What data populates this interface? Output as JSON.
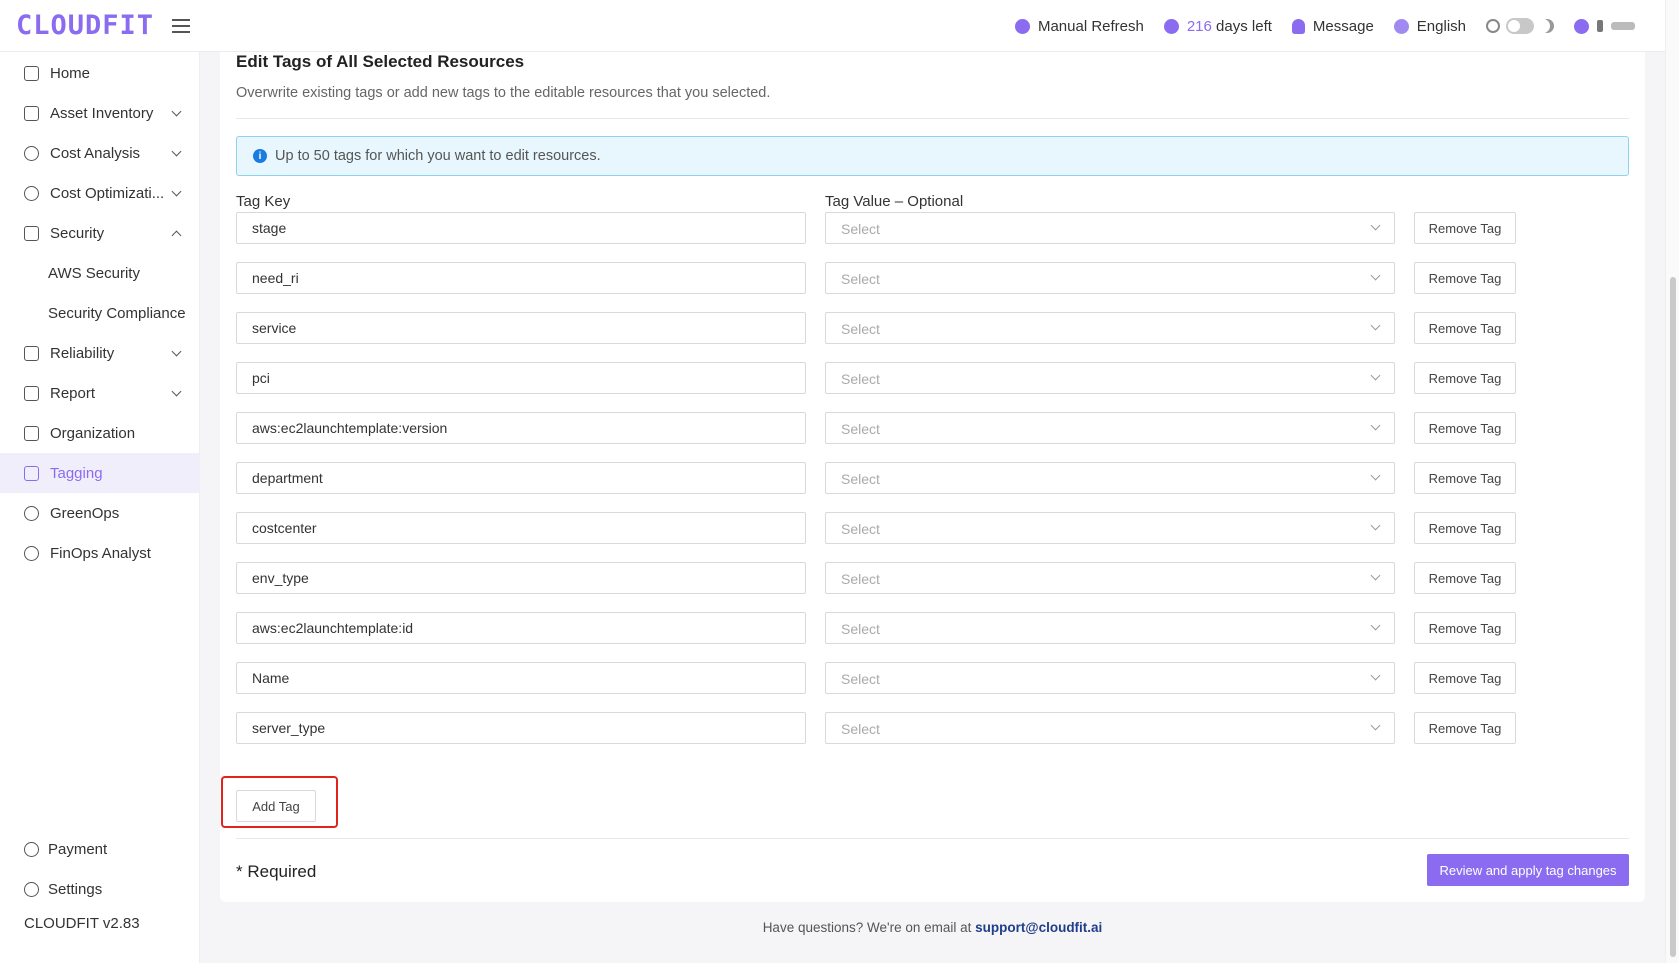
{
  "header": {
    "logo": "CLOUDFIT",
    "manual_refresh": "Manual Refresh",
    "days_left_count": "216",
    "days_left_label": "days left",
    "message": "Message",
    "language": "English"
  },
  "sidebar": {
    "items": [
      {
        "label": "Home",
        "icon": "home-icon"
      },
      {
        "label": "Asset Inventory",
        "icon": "inventory-icon"
      },
      {
        "label": "Cost Analysis",
        "icon": "gauge-icon"
      },
      {
        "label": "Cost Optimizati...",
        "icon": "dollar-icon"
      },
      {
        "label": "Security",
        "icon": "alarm-icon"
      },
      {
        "label": "AWS Security"
      },
      {
        "label": "Security Compliance"
      },
      {
        "label": "Reliability",
        "icon": "report-check-icon"
      },
      {
        "label": "Report",
        "icon": "document-icon"
      },
      {
        "label": "Organization",
        "icon": "org-chart-icon"
      },
      {
        "label": "Tagging",
        "icon": "tag-icon"
      },
      {
        "label": "GreenOps",
        "icon": "leaf-icon"
      },
      {
        "label": "FinOps Analyst",
        "icon": "analyst-icon"
      }
    ],
    "payment": "Payment",
    "settings": "Settings",
    "version": "CLOUDFIT v2.83"
  },
  "main": {
    "title": "Edit Tags of All Selected Resources",
    "subtitle": "Overwrite existing tags or add new tags to the editable resources that you selected.",
    "info": "Up to 50 tags for which you want to edit resources.",
    "col_key": "Tag Key",
    "col_value": "Tag Value – Optional",
    "select_placeholder": "Select",
    "remove_label": "Remove Tag",
    "tags": [
      "stage",
      "need_ri",
      "service",
      "pci",
      "aws:ec2launchtemplate:version",
      "department",
      "costcenter",
      "env_type",
      "aws:ec2launchtemplate:id",
      "Name",
      "server_type"
    ],
    "add_label": "Add Tag",
    "required": "* Required",
    "apply_label": "Review and apply tag changes"
  },
  "footer": {
    "text": "Have questions? We're on email at",
    "email": "support@cloudfit.ai"
  },
  "colors": {
    "accent": "#8b6cf0",
    "highlight": "#e0241b",
    "info_bg": "#e8f7fd"
  }
}
